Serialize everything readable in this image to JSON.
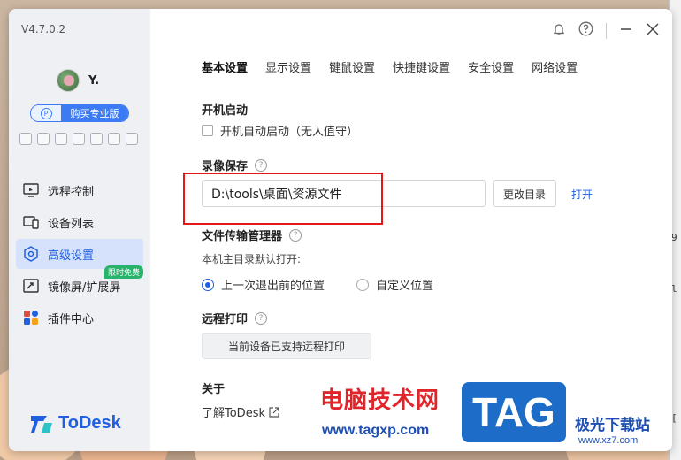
{
  "app": {
    "version": "V4.7.0.2",
    "user_name": "Y.",
    "pro_icon": "P",
    "pro_label": "购买专业版",
    "logo_text": "ToDesk",
    "mini_icons": [
      "gamepad-icon",
      "monitor-icon",
      "card-icon",
      "tablet-icon",
      "bulb-icon",
      "chip-icon",
      "more-icon"
    ]
  },
  "sidebar": {
    "items": [
      {
        "label": "远程控制",
        "icon": "remote-control-icon"
      },
      {
        "label": "设备列表",
        "icon": "device-list-icon"
      },
      {
        "label": "高级设置",
        "icon": "settings-icon"
      },
      {
        "label": "镜像屏/扩展屏",
        "icon": "mirror-icon",
        "badge": "限时免费"
      },
      {
        "label": "插件中心",
        "icon": "plugin-icon"
      }
    ],
    "active": "高级设置"
  },
  "tabs": [
    "基本设置",
    "显示设置",
    "键鼠设置",
    "快捷键设置",
    "安全设置",
    "网络设置"
  ],
  "active_tab": "基本设置",
  "startup": {
    "title": "开机启动",
    "checkbox_label": "开机自动启动（无人值守）",
    "checked": false
  },
  "recording": {
    "title": "录像保存",
    "help": "?",
    "path": "D:\\tools\\桌面\\资源文件",
    "change_button": "更改目录",
    "open_link": "打开"
  },
  "file_transfer": {
    "title": "文件传输管理器",
    "help": "?",
    "subtitle": "本机主目录默认打开:",
    "options": [
      "上一次退出前的位置",
      "自定义位置"
    ],
    "selected": "上一次退出前的位置"
  },
  "remote_print": {
    "title": "远程打印",
    "help": "?",
    "button": "当前设备已支持远程打印"
  },
  "about": {
    "title": "关于",
    "link": "了解ToDesk"
  },
  "watermark": {
    "cn": "电脑技术网",
    "url": "www.tagxp.com",
    "tag": "TAG",
    "site": "极光下载站",
    "site_url": "www.xz7.com"
  },
  "desktop_edge": [
    "9",
    "l",
    "["
  ]
}
